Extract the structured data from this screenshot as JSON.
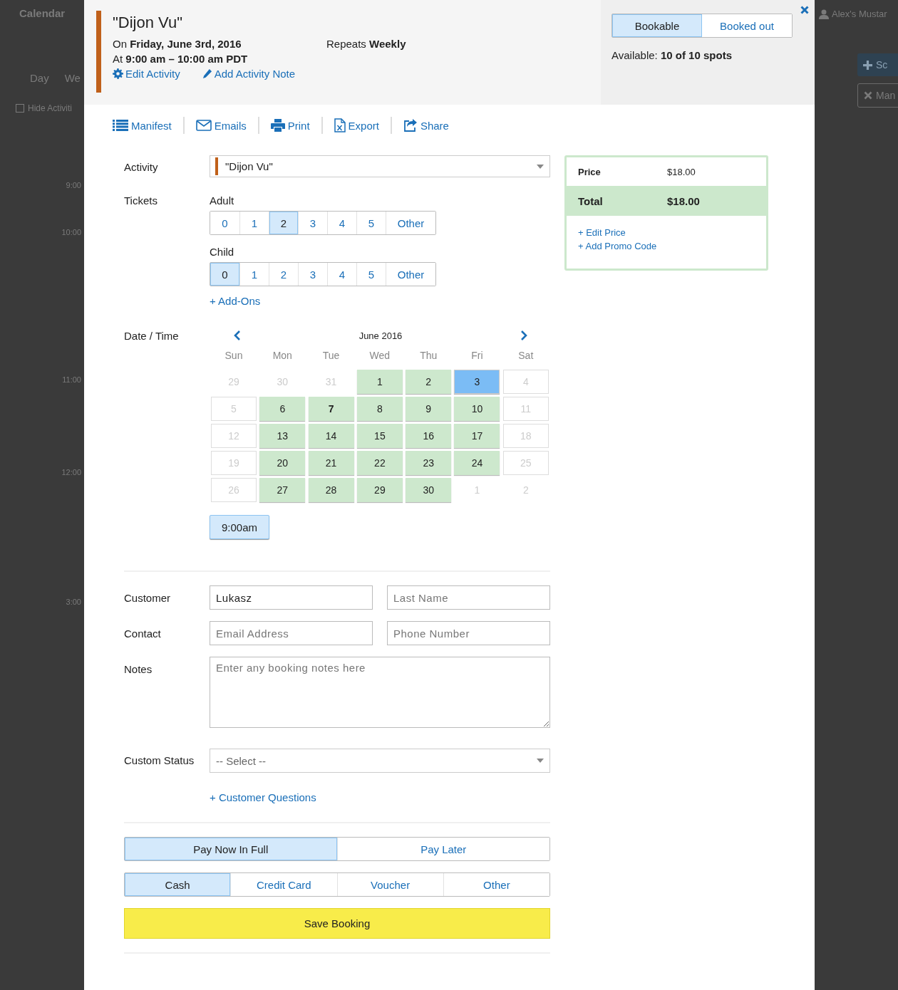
{
  "backdrop": {
    "title": "Calendar",
    "view_tabs": [
      "Day",
      "We"
    ],
    "hide_activities": {
      "label": "Hide Activiti",
      "checked": false
    },
    "times": [
      "9:00",
      "10:00",
      "11:00",
      "12:00",
      "3:00"
    ],
    "user": "Alex's Mustar",
    "buttons": [
      {
        "label": "Sc"
      },
      {
        "label": "Man"
      }
    ]
  },
  "header": {
    "title": "\"Dijon Vu\"",
    "color": "#c0601a",
    "date": "On **Friday, June 3rd, 2016**",
    "time": "At **9:00 am – 10:00 am PDT**",
    "repeats": "Repeats **Weekly**",
    "links": [
      {
        "label": "Edit Activity"
      },
      {
        "label": "Add Activity Note"
      }
    ],
    "status": [
      {
        "label": "Bookable",
        "selected": true
      },
      {
        "label": "Booked out",
        "selected": false
      }
    ],
    "availability": "Available: **10 of 10 spots**"
  },
  "toolbar": [
    {
      "label": "Manifest"
    },
    {
      "label": "Emails"
    },
    {
      "label": "Print"
    },
    {
      "label": "Export"
    },
    {
      "label": "Share"
    }
  ],
  "form": {
    "activity": {
      "label": "Activity",
      "value": "\"Dijon Vu\"",
      "color": "#c0601a"
    },
    "tickets_label": "Tickets",
    "tickets": [
      {
        "label": "Adult",
        "options": [
          {
            "label": "0",
            "selected": false
          },
          {
            "label": "1",
            "selected": false
          },
          {
            "label": "2",
            "selected": true
          },
          {
            "label": "3",
            "selected": false
          },
          {
            "label": "4",
            "selected": false
          },
          {
            "label": "5",
            "selected": false
          },
          {
            "label": "Other",
            "selected": false
          }
        ]
      },
      {
        "label": "Child",
        "options": [
          {
            "label": "0",
            "selected": true
          },
          {
            "label": "1",
            "selected": false
          },
          {
            "label": "2",
            "selected": false
          },
          {
            "label": "3",
            "selected": false
          },
          {
            "label": "4",
            "selected": false
          },
          {
            "label": "5",
            "selected": false
          },
          {
            "label": "Other",
            "selected": false
          }
        ]
      }
    ],
    "addons": "+ Add-Ons",
    "date_label": "Date / Time",
    "calendar": {
      "month": "June 2016",
      "weekdays": [
        "Sun",
        "Mon",
        "Tue",
        "Wed",
        "Thu",
        "Fri",
        "Sat"
      ],
      "weeks": [
        [
          {
            "label": "29",
            "kind": "other-month",
            "selected": false,
            "today": false
          },
          {
            "label": "30",
            "kind": "other-month",
            "selected": false,
            "today": false
          },
          {
            "label": "31",
            "kind": "other-month",
            "selected": false,
            "today": false
          },
          {
            "label": "1",
            "kind": "open",
            "selected": false,
            "today": false
          },
          {
            "label": "2",
            "kind": "open",
            "selected": false,
            "today": false
          },
          {
            "label": "3",
            "kind": "open",
            "selected": true,
            "today": false
          },
          {
            "label": "4",
            "kind": "closed",
            "selected": false,
            "today": false
          }
        ],
        [
          {
            "label": "5",
            "kind": "closed",
            "selected": false,
            "today": false
          },
          {
            "label": "6",
            "kind": "open",
            "selected": false,
            "today": false
          },
          {
            "label": "7",
            "kind": "open",
            "selected": false,
            "today": true
          },
          {
            "label": "8",
            "kind": "open",
            "selected": false,
            "today": false
          },
          {
            "label": "9",
            "kind": "open",
            "selected": false,
            "today": false
          },
          {
            "label": "10",
            "kind": "open",
            "selected": false,
            "today": false
          },
          {
            "label": "11",
            "kind": "closed",
            "selected": false,
            "today": false
          }
        ],
        [
          {
            "label": "12",
            "kind": "closed",
            "selected": false,
            "today": false
          },
          {
            "label": "13",
            "kind": "open",
            "selected": false,
            "today": false
          },
          {
            "label": "14",
            "kind": "open",
            "selected": false,
            "today": false
          },
          {
            "label": "15",
            "kind": "open",
            "selected": false,
            "today": false
          },
          {
            "label": "16",
            "kind": "open",
            "selected": false,
            "today": false
          },
          {
            "label": "17",
            "kind": "open",
            "selected": false,
            "today": false
          },
          {
            "label": "18",
            "kind": "closed",
            "selected": false,
            "today": false
          }
        ],
        [
          {
            "label": "19",
            "kind": "closed",
            "selected": false,
            "today": false
          },
          {
            "label": "20",
            "kind": "open",
            "selected": false,
            "today": false
          },
          {
            "label": "21",
            "kind": "open",
            "selected": false,
            "today": false
          },
          {
            "label": "22",
            "kind": "open",
            "selected": false,
            "today": false
          },
          {
            "label": "23",
            "kind": "open",
            "selected": false,
            "today": false
          },
          {
            "label": "24",
            "kind": "open",
            "selected": false,
            "today": false
          },
          {
            "label": "25",
            "kind": "closed",
            "selected": false,
            "today": false
          }
        ],
        [
          {
            "label": "26",
            "kind": "closed",
            "selected": false,
            "today": false
          },
          {
            "label": "27",
            "kind": "open",
            "selected": false,
            "today": false
          },
          {
            "label": "28",
            "kind": "open",
            "selected": false,
            "today": false
          },
          {
            "label": "29",
            "kind": "open",
            "selected": false,
            "today": false
          },
          {
            "label": "30",
            "kind": "open",
            "selected": false,
            "today": false
          },
          {
            "label": "1",
            "kind": "other-month",
            "selected": false,
            "today": false
          },
          {
            "label": "2",
            "kind": "other-month",
            "selected": false,
            "today": false
          }
        ]
      ]
    },
    "times": [
      {
        "label": "9:00am",
        "selected": true
      }
    ],
    "customer_label": "Customer",
    "first_name": {
      "value": "Lukasz"
    },
    "last_name": {
      "placeholder": "Last Name"
    },
    "contact_label": "Contact",
    "email": {
      "placeholder": "Email Address"
    },
    "phone": {
      "placeholder": "Phone Number"
    },
    "notes_label": "Notes",
    "notes": {
      "placeholder": "Enter any booking notes here"
    },
    "status_label": "Custom Status",
    "status": {
      "value": "-- Select --"
    },
    "questions": "+ Customer Questions",
    "payment_timing": [
      {
        "label": "Pay Now In Full",
        "selected": true
      },
      {
        "label": "Pay Later",
        "selected": false
      }
    ],
    "payment_method": [
      {
        "label": "Cash",
        "selected": true
      },
      {
        "label": "Credit Card",
        "selected": false
      },
      {
        "label": "Voucher",
        "selected": false
      },
      {
        "label": "Other",
        "selected": false
      }
    ],
    "save": "Save Booking"
  },
  "price": {
    "rows": [
      {
        "label": "Price",
        "value": "$18.00",
        "kind": "line"
      },
      {
        "label": "Total",
        "value": "$18.00",
        "kind": "total"
      }
    ],
    "links": [
      "+ Edit Price",
      "+ Add Promo Code"
    ]
  }
}
